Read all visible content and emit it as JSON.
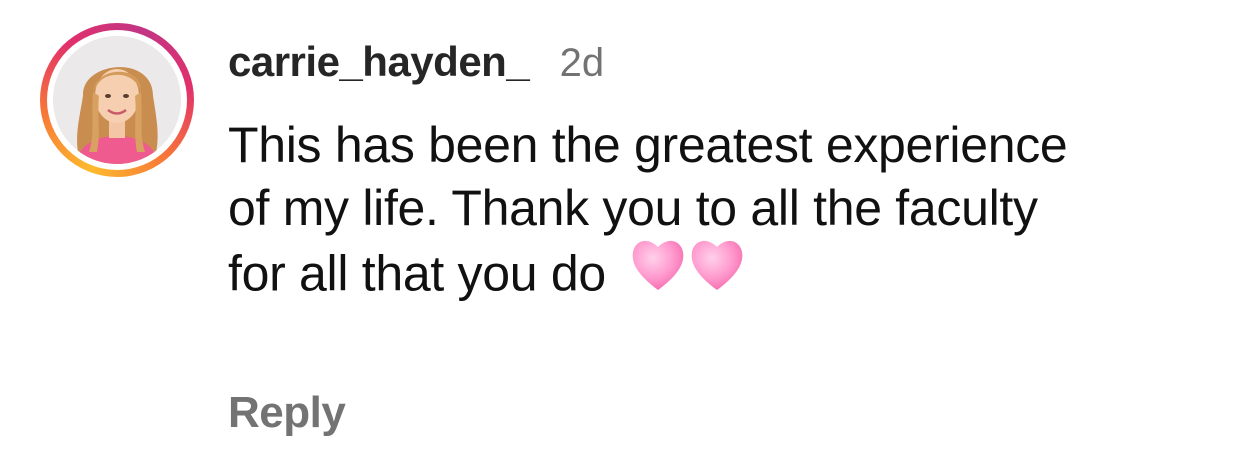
{
  "comment": {
    "username": "carrie_hayden_",
    "time": "2d",
    "text": "This has been the greatest experience of my life. Thank you to all the faculty for all that you do",
    "emoji": [
      "pink-heart",
      "pink-heart"
    ],
    "reply_label": "Reply"
  },
  "colors": {
    "username": "#262626",
    "secondary": "#737373",
    "heart": "#ff8fc8",
    "ring_gradient": [
      "#fdbb2d",
      "#f77737",
      "#e1306c",
      "#c13584"
    ]
  }
}
